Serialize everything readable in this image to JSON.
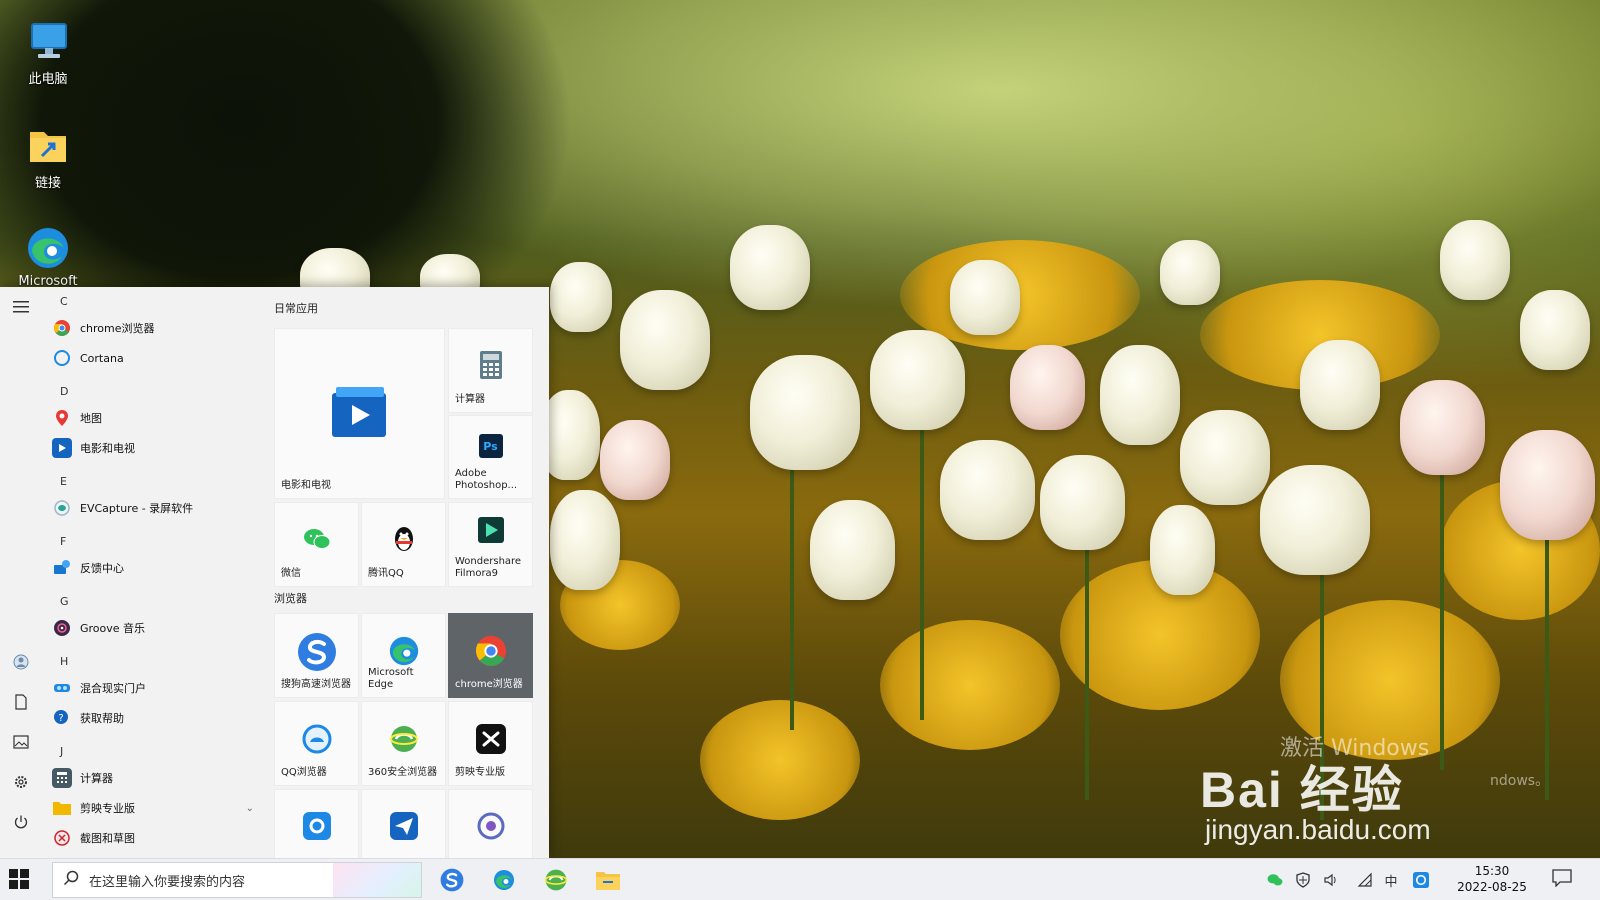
{
  "desktop": {
    "icons": [
      {
        "label": "此电脑"
      },
      {
        "label": "链接"
      },
      {
        "label": "Microsoft"
      }
    ]
  },
  "watermark": {
    "line1": "激活 Windows",
    "brand": "Bai 经验",
    "url": "jingyan.baidu.com",
    "line4": "ndows。"
  },
  "start_menu": {
    "app_list": [
      {
        "type": "letter",
        "text": "C"
      },
      {
        "type": "app",
        "label": "chrome浏览器",
        "icon": "chrome-icon",
        "color": "#e94235"
      },
      {
        "type": "app",
        "label": "Cortana",
        "icon": "cortana-icon",
        "color": "#1e88e5"
      },
      {
        "type": "letter",
        "text": "D"
      },
      {
        "type": "app",
        "label": "地图",
        "icon": "map-pin-icon",
        "color": "#e53935"
      },
      {
        "type": "app",
        "label": "电影和电视",
        "icon": "movies-icon",
        "color": "#1565c0"
      },
      {
        "type": "letter",
        "text": "E"
      },
      {
        "type": "app",
        "label": "EVCapture - 录屏软件",
        "icon": "evcapture-icon",
        "color": "#26a69a"
      },
      {
        "type": "letter",
        "text": "F"
      },
      {
        "type": "app",
        "label": "反馈中心",
        "icon": "feedback-icon",
        "color": "#1976d2"
      },
      {
        "type": "letter",
        "text": "G"
      },
      {
        "type": "app",
        "label": "Groove 音乐",
        "icon": "groove-icon",
        "color": "#6a1b9a"
      },
      {
        "type": "letter",
        "text": "H"
      },
      {
        "type": "app",
        "label": "混合现实门户",
        "icon": "mixed-reality-icon",
        "color": "#1e88e5"
      },
      {
        "type": "app",
        "label": "获取帮助",
        "icon": "help-icon",
        "color": "#1565c0"
      },
      {
        "type": "letter",
        "text": "J"
      },
      {
        "type": "app",
        "label": "计算器",
        "icon": "calculator-icon",
        "color": "#455a64"
      },
      {
        "type": "folder",
        "label": "剪映专业版",
        "icon": "folder-icon",
        "color": "#f2b800"
      },
      {
        "type": "app",
        "label": "截图和草图",
        "icon": "snip-icon",
        "color": "#c62828"
      }
    ],
    "groups": [
      {
        "label": "日常应用"
      },
      {
        "label": "浏览器"
      }
    ],
    "tiles": {
      "movies": "电影和电视",
      "calculator": "计算器",
      "photoshop": "Adobe Photoshop...",
      "wechat": "微信",
      "qq": "腾讯QQ",
      "filmora": "Wondershare Filmora9",
      "sogou": "搜狗高速浏览器",
      "edge": "Microsoft Edge",
      "chrome": "chrome浏览器",
      "qqbrowser": "QQ浏览器",
      "browser360": "360安全浏览器",
      "capcut": "剪映专业版"
    },
    "photoshop_badge": "Ps"
  },
  "taskbar": {
    "search_placeholder": "在这里输入你要搜索的内容",
    "time": "15:30",
    "date": "2022-08-25",
    "ime": "中"
  }
}
